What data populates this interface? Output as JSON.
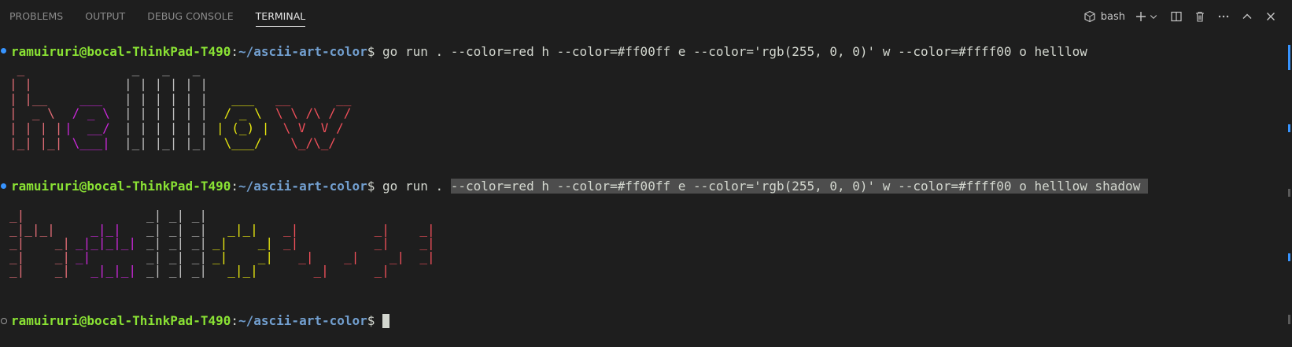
{
  "tabs": [
    {
      "label": "PROBLEMS"
    },
    {
      "label": "OUTPUT"
    },
    {
      "label": "DEBUG CONSOLE"
    },
    {
      "label": "TERMINAL"
    }
  ],
  "actions": {
    "shell": "bash"
  },
  "terminal": {
    "user": "ramuiruri@bocal-ThinkPad-T490",
    "path": "~/ascii-art-color",
    "prompt": "$",
    "cmd1": " go run . --color=red h --color=#ff00ff e --color='rgb(255, 0, 0)' w --color=#ffff00 o helllow",
    "cmd2_prefix": " go run . ",
    "cmd2_selected": "--color=red h --color=#ff00ff e --color='rgb(255, 0, 0)' w --color=#ffff00 o helllow shadow ",
    "art1": {
      "h": " _     \n| |    \n| |__  \n|  _ \\ \n| | | |\n|_| |_|",
      "e": "        \n        \n  ___   \n / _ \\  \n|  __/  \n \\___|  ",
      "lll": " _   _   _  \n| | | | | | \n| | | | | | \n| | | | | | \n| | | | | | \n|_| |_| |_| ",
      "o": "        \n        \n  ___   \n / _ \\  \n| (_) | \n \\___/  ",
      "w": "             \n             \n__      __   \n\\ \\ /\\ / /   \n \\ V  V /    \n  \\_/\\_/     "
    },
    "art2": {
      "h": "_|      \n_|_|_|  \n_|    _|\n_|    _|\n_|    _|",
      "e": "        \n  _|_|  \n_|_|_|_|\n_|      \n  _|_|_|",
      "lll": "_| _| _|\n_| _| _|\n_| _| _|\n_| _| _|\n_| _| _|",
      "o": "          \n  _|_|    \n_|    _|  \n_|    _|  \n  _|_|    ",
      "w": "                    \n_|          _|    _|\n_|          _|    _|\n  _|    _|    _|  _| \n    _|      _|      "
    }
  }
}
